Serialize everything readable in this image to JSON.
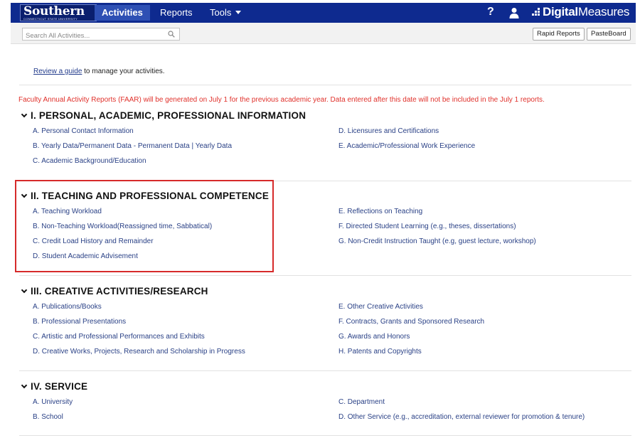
{
  "nav": {
    "logo": "Southern",
    "logo_sub": "CONNECTICUT STATE UNIVERSITY",
    "tabs": [
      {
        "label": "Activities"
      },
      {
        "label": "Reports"
      },
      {
        "label": "Tools"
      }
    ],
    "help": "?",
    "brand_prefix": "Digital",
    "brand_suffix": "Measures"
  },
  "toolbar": {
    "search_placeholder": "Search All Activities...",
    "rapid_reports": "Rapid Reports",
    "pasteboard": "PasteBoard"
  },
  "guide": {
    "link": "Review a guide",
    "text": " to manage your activities."
  },
  "notice": "Faculty Annual Activity Reports (FAAR) will be generated on July 1 for the previous academic year. Data entered after this date will not be included in the July 1 reports.",
  "sections": [
    {
      "title": "I. PERSONAL, ACADEMIC, PROFESSIONAL INFORMATION",
      "left": [
        "A. Personal Contact Information",
        "B. Yearly Data/Permanent Data - Permanent Data",
        "C. Academic Background/Education"
      ],
      "left_extra": "Yearly Data",
      "right": [
        "D. Licensures and Certifications",
        "E. Academic/Professional Work Experience"
      ]
    },
    {
      "title": "II. TEACHING AND PROFESSIONAL COMPETENCE",
      "left": [
        "A. Teaching Workload",
        "B. Non-Teaching Workload(Reassigned time, Sabbatical)",
        "C. Credit Load History and Remainder",
        "D. Student Academic Advisement"
      ],
      "right": [
        "E. Reflections on Teaching",
        "F. Directed Student Learning (e.g., theses, dissertations)",
        "G. Non-Credit Instruction Taught (e.g, guest lecture, workshop)"
      ]
    },
    {
      "title": "III. CREATIVE ACTIVITIES/RESEARCH",
      "left": [
        "A. Publications/Books",
        "B. Professional Presentations",
        "C. Artistic and Professional Performances and Exhibits",
        "D. Creative Works, Projects, Research and Scholarship in Progress"
      ],
      "right": [
        "E. Other Creative Activities",
        "F. Contracts, Grants and Sponsored Research",
        "G. Awards and Honors",
        "H. Patents and Copyrights"
      ]
    },
    {
      "title": "IV. SERVICE",
      "left": [
        "A. University",
        "B. School"
      ],
      "right": [
        "C. Department",
        "D. Other Service (e.g., accreditation, external reviewer for promotion & tenure)"
      ]
    }
  ],
  "colors": {
    "nav_bg": "#0e2a8f",
    "active_tab": "#2e50b4",
    "link": "#2a4186",
    "notice": "#e0312b",
    "highlight_box": "#d62a2a"
  }
}
